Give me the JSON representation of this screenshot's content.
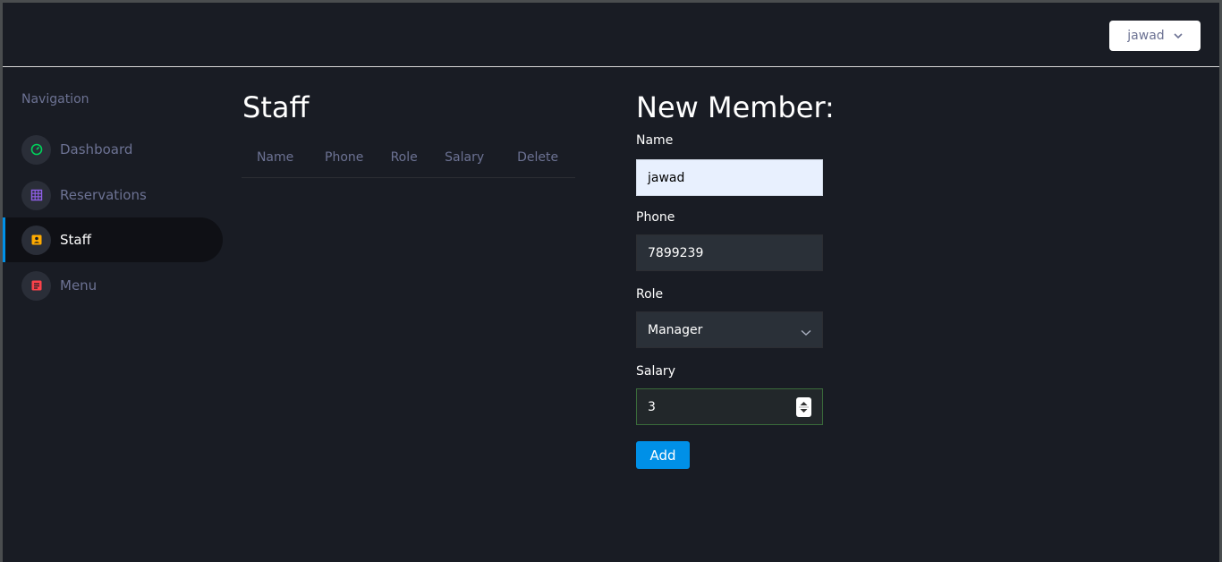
{
  "header": {
    "user_name": "jawad"
  },
  "sidebar": {
    "heading": "Navigation",
    "items": [
      {
        "label": "Dashboard",
        "icon": "speedometer-icon",
        "color": "#00d25b"
      },
      {
        "label": "Reservations",
        "icon": "table-grid-icon",
        "color": "#8f5fe8"
      },
      {
        "label": "Staff",
        "icon": "contacts-icon",
        "color": "#ffab00",
        "active": true
      },
      {
        "label": "Menu",
        "icon": "note-icon",
        "color": "#fc424a"
      }
    ]
  },
  "staff": {
    "title": "Staff",
    "columns": [
      "Name",
      "Phone",
      "Role",
      "Salary",
      "Delete"
    ],
    "rows": []
  },
  "form": {
    "title": "New Member:",
    "name_label": "Name",
    "name_value": "jawad",
    "phone_label": "Phone",
    "phone_value": "7899239",
    "role_label": "Role",
    "role_value": "Manager",
    "salary_label": "Salary",
    "salary_value": "3",
    "add_label": "Add"
  },
  "colors": {
    "background": "#191c24",
    "accent": "#0090e7"
  }
}
